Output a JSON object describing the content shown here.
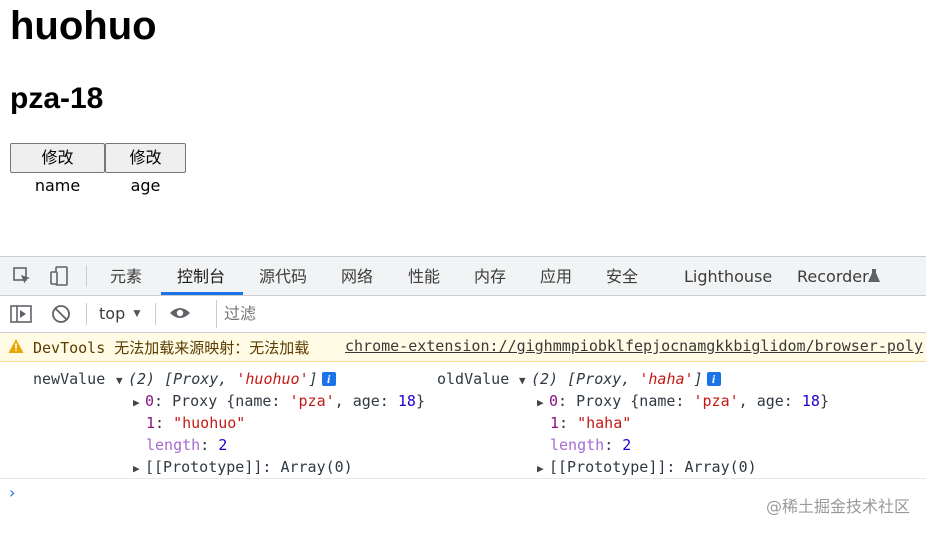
{
  "page": {
    "heading1": "huohuo",
    "heading2": "pza-18",
    "buttons": [
      "修改name",
      "修改age"
    ]
  },
  "devtools": {
    "tabs": [
      "元素",
      "控制台",
      "源代码",
      "网络",
      "性能",
      "内存",
      "应用",
      "安全",
      "Lighthouse",
      "Recorder"
    ],
    "active_tab": "控制台",
    "context": "top",
    "filter_placeholder": "过滤",
    "warning": {
      "text": "DevTools 无法加载来源映射：无法加载",
      "link": "chrome-extension://gighmmpiobklfepjocnamgkkbiglidom/browser-poly"
    },
    "console": {
      "new_label": "newValue",
      "old_label": "oldValue",
      "new_summary_prefix": "(2) [Proxy, ",
      "new_summary_str": "'huohuo'",
      "old_summary_str": "'haha'",
      "summary_suffix": "]",
      "proxy_line_key": "0",
      "proxy_text": "Proxy {name: ",
      "proxy_name": "'pza'",
      "proxy_age_label": ", age: ",
      "proxy_age": "18",
      "proxy_close": "}",
      "item1_key": "1",
      "new_item1": "\"huohuo\"",
      "old_item1": "\"haha\"",
      "length_key": "length",
      "length_val": "2",
      "prototype_key": "[[Prototype]]",
      "prototype_val": ": Array(0)"
    },
    "prompt_symbol": "›"
  },
  "watermark": "@稀土掘金技术社区",
  "colors": {
    "accent": "#1a73e8",
    "warning_bg": "#fffbe5"
  }
}
